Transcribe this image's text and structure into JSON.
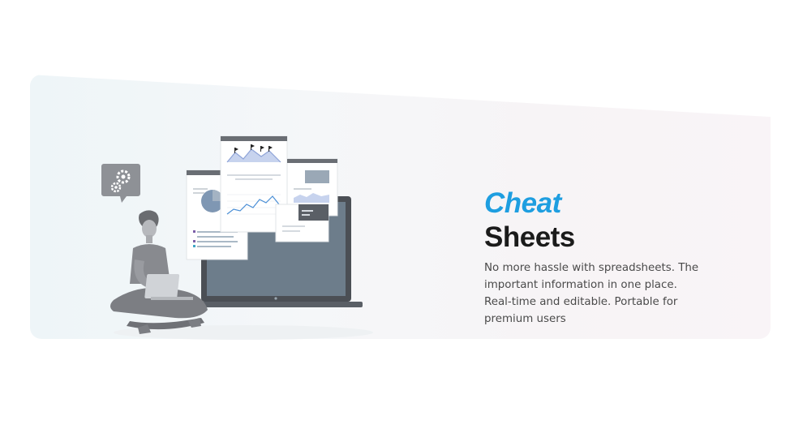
{
  "hero": {
    "title_line1": "Cheat",
    "title_line2": "Sheets",
    "description": "No more hassle with spreadsheets. The important information in one place. Real-time and editable. Portable for premium users"
  },
  "colors": {
    "accent": "#1e9ee0",
    "heading": "#1b1b1b",
    "body_text": "#4a4a4a"
  },
  "illustration": {
    "subject": "person-with-laptop-and-floating-documents",
    "icons": [
      "gear-icon",
      "laptop-icon",
      "document-icon",
      "chart-icon"
    ]
  }
}
